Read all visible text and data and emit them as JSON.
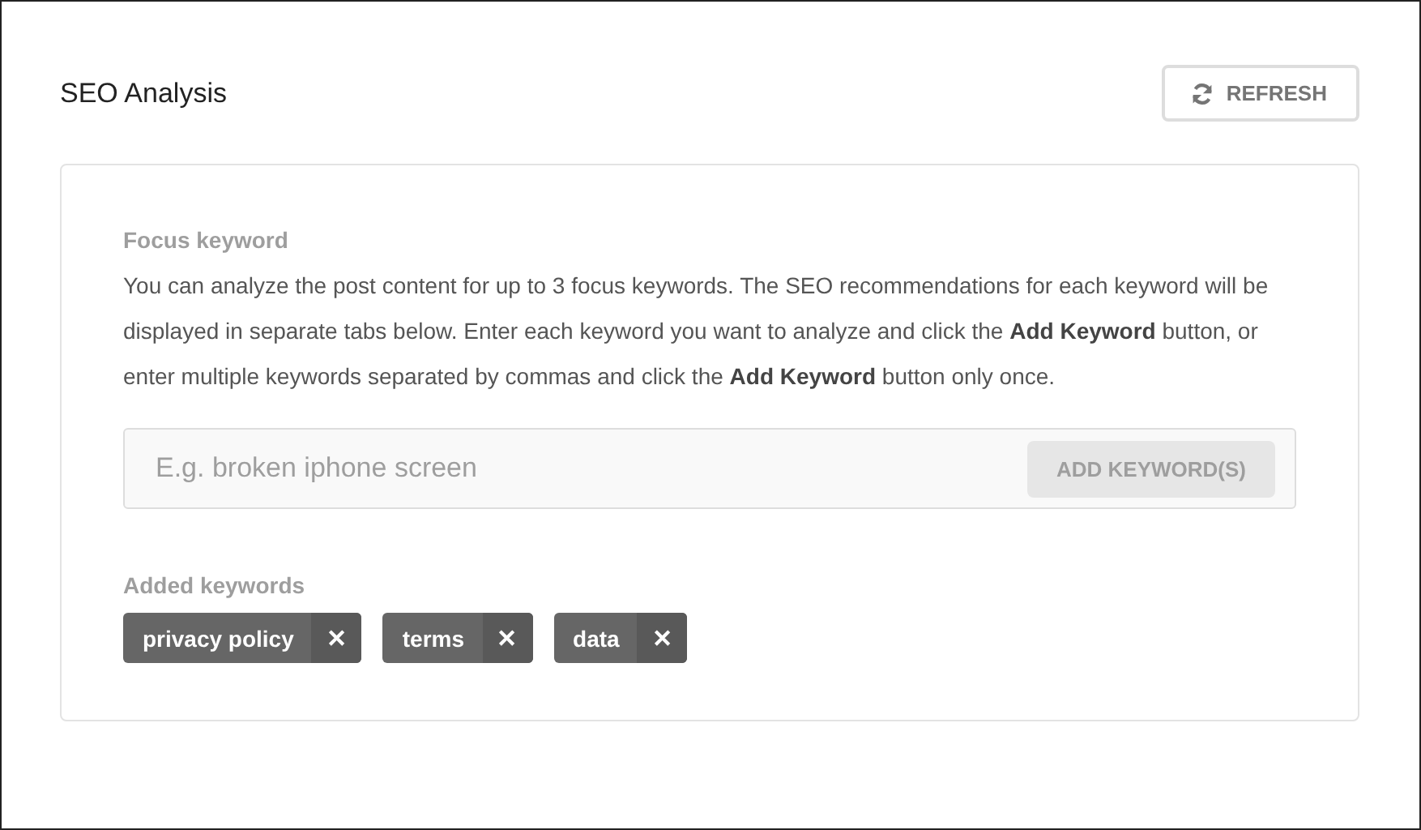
{
  "header": {
    "title": "SEO Analysis",
    "refresh_button": "REFRESH"
  },
  "focus": {
    "label": "Focus keyword",
    "description": "You can analyze the post content for up to 3 focus keywords. The SEO recommendations for each keyword will be displayed in separate tabs below. Enter each keyword you want to analyze and click the **Add Keyword** button, or enter multiple keywords separated by commas and click the **Add Keyword** button only once.",
    "input": {
      "placeholder": "E.g. broken iphone screen"
    },
    "add_button": "ADD KEYWORD(S)"
  },
  "added": {
    "label": "Added keywords",
    "keywords": [
      {
        "text": "privacy policy",
        "remove": "✕"
      },
      {
        "text": "terms",
        "remove": "✕"
      },
      {
        "text": "data",
        "remove": "✕"
      }
    ]
  }
}
